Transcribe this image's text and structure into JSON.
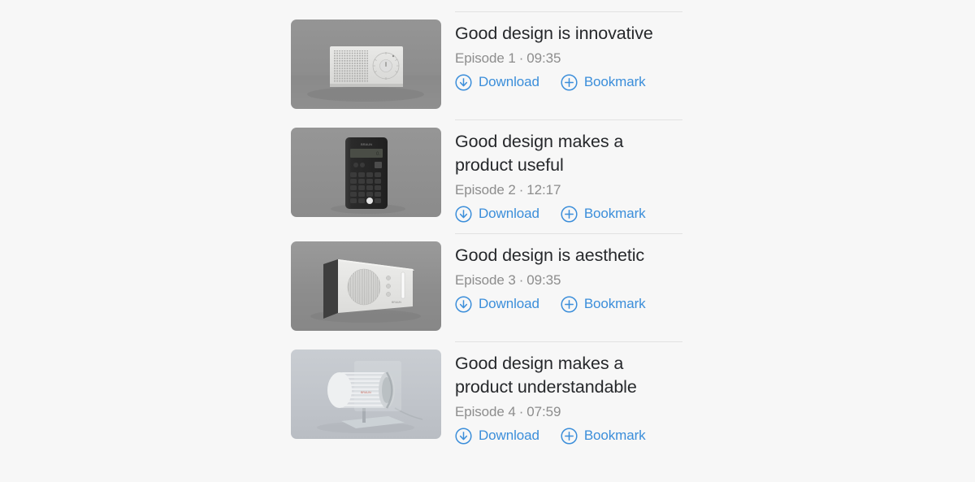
{
  "theme": {
    "background": "#f7f7f7",
    "link_accent": "#3b8eda",
    "title_color": "#26282b",
    "meta_color": "#8d8d8d",
    "divider_color": "#e2e2e2"
  },
  "actions": {
    "download_label": "Download",
    "bookmark_label": "Bookmark",
    "download_icon": "download-circle-icon",
    "bookmark_icon": "plus-circle-icon"
  },
  "separator": "·",
  "episodes": [
    {
      "title": "Good design is innovative",
      "episode_label": "Episode 1",
      "duration": "09:35",
      "thumbnail": "braun-white-radio-speaker-dial",
      "thumb_bg": "#8e8e8e"
    },
    {
      "title": "Good design makes a product useful",
      "episode_label": "Episode 2",
      "duration": "12:17",
      "thumbnail": "braun-black-calculator",
      "thumb_bg": "#8e8e8e"
    },
    {
      "title": "Good design is aesthetic",
      "episode_label": "Episode 3",
      "duration": "09:35",
      "thumbnail": "braun-white-wedge-speaker",
      "thumb_bg": "#8a8a8a"
    },
    {
      "title": "Good design makes a product understandable",
      "episode_label": "Episode 4",
      "duration": "07:59",
      "thumbnail": "braun-desk-fan-on-stand",
      "thumb_bg": "#c3c7cc"
    }
  ]
}
